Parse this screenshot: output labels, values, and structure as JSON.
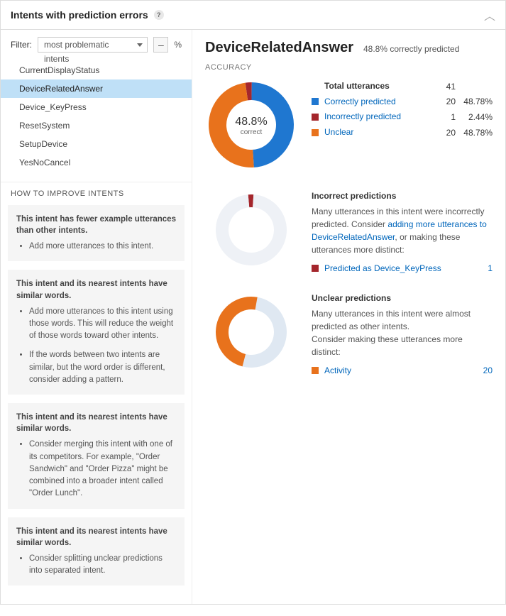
{
  "header": {
    "title": "Intents with prediction errors",
    "help_glyph": "?"
  },
  "filter": {
    "label": "Filter:",
    "selected": "most problematic intents",
    "minus_glyph": "–",
    "pct_label": "%"
  },
  "intent_list": [
    {
      "name": "CurrentDisplayStatus",
      "active": false
    },
    {
      "name": "DeviceRelatedAnswer",
      "active": true
    },
    {
      "name": "Device_KeyPress",
      "active": false
    },
    {
      "name": "ResetSystem",
      "active": false
    },
    {
      "name": "SetupDevice",
      "active": false
    },
    {
      "name": "YesNoCancel",
      "active": false
    }
  ],
  "howto": {
    "title": "HOW TO IMPROVE INTENTS",
    "tips": [
      {
        "head": "This intent has fewer example utterances than other intents.",
        "bullets": [
          "Add more utterances to this intent."
        ]
      },
      {
        "head": "This intent and its nearest intents have similar words.",
        "bullets": [
          "Add more utterances to this intent using those words. This will reduce the weight of those words toward other intents.",
          "If the words between two intents are similar, but the word order is different, consider adding a pattern."
        ]
      },
      {
        "head": "This intent and its nearest intents have similar words.",
        "bullets": [
          "Consider merging this intent with one of its competitors. For example, \"Order Sandwich\" and \"Order Pizza\" might be combined into a broader intent called \"Order Lunch\"."
        ]
      },
      {
        "head": "This intent and its nearest intents have similar words.",
        "bullets": [
          "Consider splitting unclear predictions into separated intent."
        ]
      }
    ]
  },
  "detail": {
    "title": "DeviceRelatedAnswer",
    "subtitle": "48.8% correctly predicted",
    "accuracy_label": "ACCURACY",
    "donut_center_top": "48.8%",
    "donut_center_bottom": "correct",
    "total_row": {
      "label": "Total utterances",
      "count": "41",
      "pct": ""
    },
    "breakdown": [
      {
        "swatch": "sw-blue",
        "label": "Correctly predicted",
        "count": "20",
        "pct": "48.78%"
      },
      {
        "swatch": "sw-red",
        "label": "Incorrectly predicted",
        "count": "1",
        "pct": "2.44%"
      },
      {
        "swatch": "sw-orange",
        "label": "Unclear",
        "count": "20",
        "pct": "48.78%"
      }
    ],
    "incorrect": {
      "head": "Incorrect predictions",
      "desc_prefix": "Many utterances in this intent were incorrectly predicted. Consider ",
      "desc_link": "adding more utterances to DeviceRelatedAnswer",
      "desc_suffix": ", or making these utterances more distinct:",
      "items": [
        {
          "swatch": "sw-red",
          "label": "Predicted as Device_KeyPress",
          "count": "1"
        }
      ]
    },
    "unclear": {
      "head": "Unclear predictions",
      "desc_line1": "Many utterances in this intent were almost predicted as other intents.",
      "desc_line2": "Consider making these utterances more distinct:",
      "items": [
        {
          "swatch": "sw-orange",
          "label": "Activity",
          "count": "20"
        }
      ]
    }
  },
  "chart_data": [
    {
      "type": "pie",
      "name": "accuracy-donut",
      "title": "Accuracy",
      "series": [
        {
          "name": "Correctly predicted",
          "value": 20,
          "pct": 48.78,
          "color": "#1f77d0"
        },
        {
          "name": "Incorrectly predicted",
          "value": 1,
          "pct": 2.44,
          "color": "#a4262c"
        },
        {
          "name": "Unclear",
          "value": 20,
          "pct": 48.78,
          "color": "#e8721c"
        }
      ],
      "center_label": "48.8% correct"
    },
    {
      "type": "pie",
      "name": "incorrect-donut",
      "title": "Incorrect predictions",
      "series": [
        {
          "name": "Predicted as Device_KeyPress",
          "value": 1,
          "color": "#a4262c"
        },
        {
          "name": "Other",
          "value": 40,
          "color": "#dfe8f2"
        }
      ]
    },
    {
      "type": "pie",
      "name": "unclear-donut",
      "title": "Unclear predictions",
      "series": [
        {
          "name": "Activity",
          "value": 20,
          "color": "#e8721c"
        },
        {
          "name": "Other",
          "value": 21,
          "color": "#dfe8f2"
        }
      ]
    }
  ]
}
